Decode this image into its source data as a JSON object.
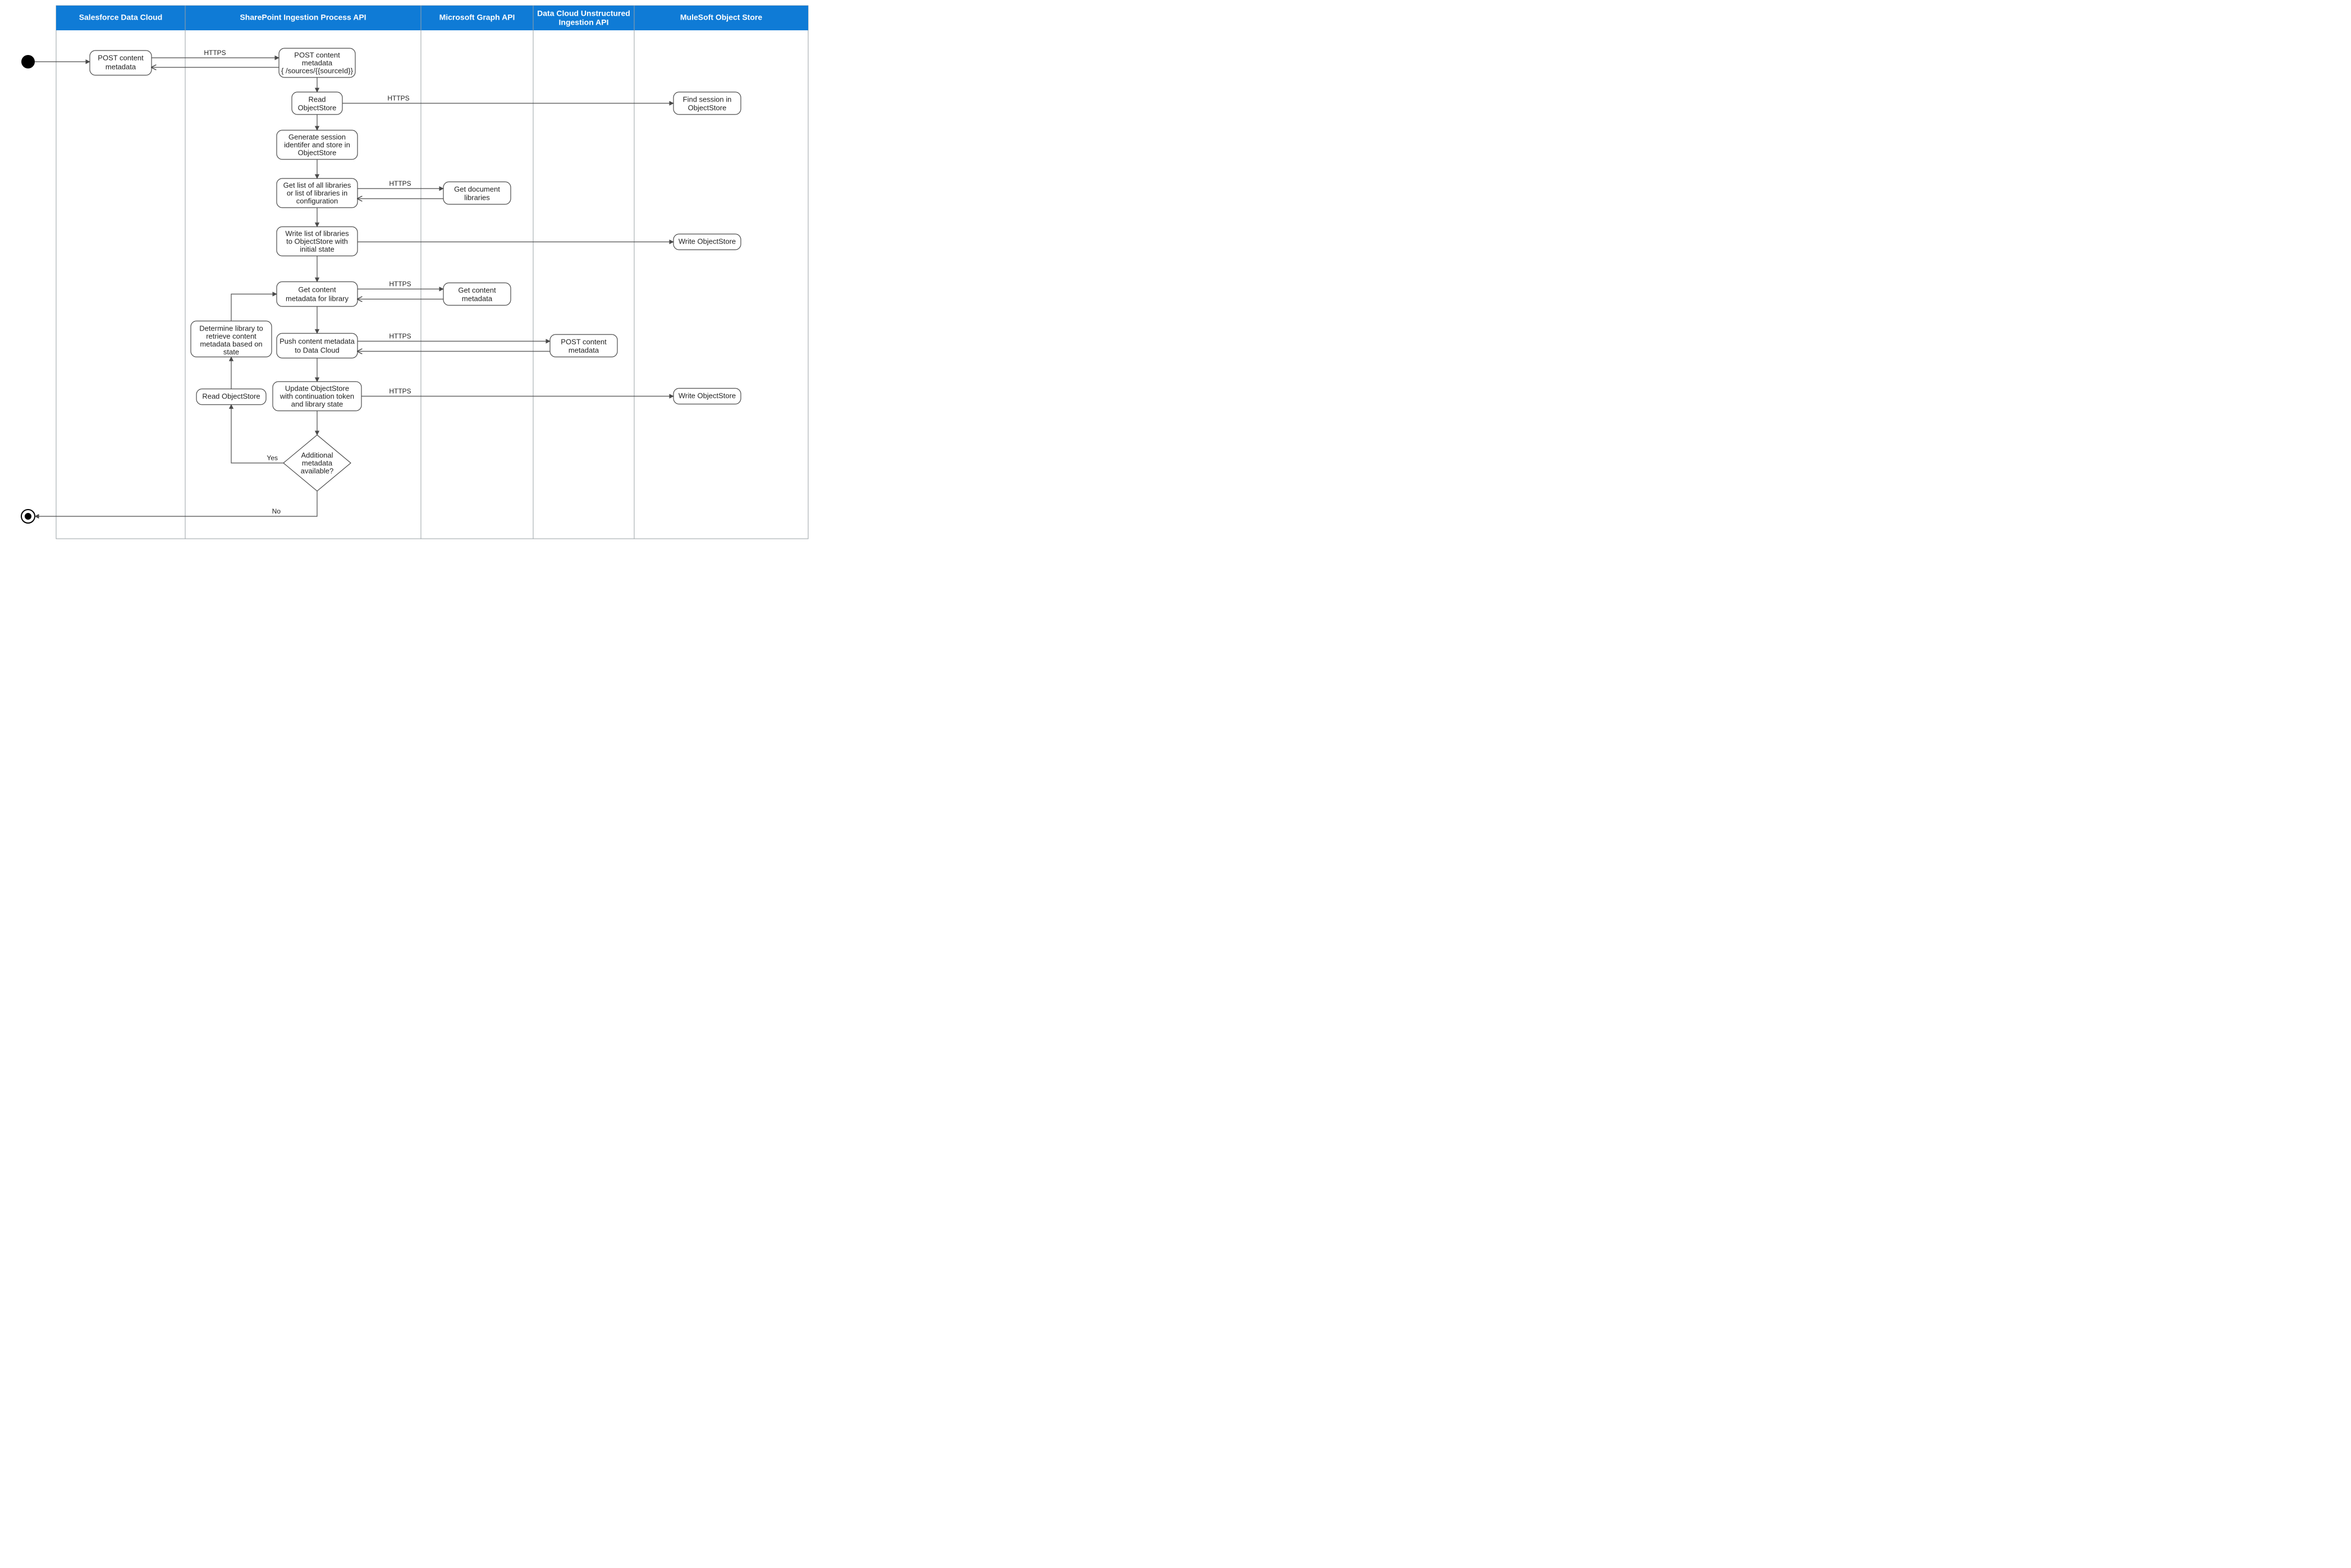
{
  "lanes": [
    {
      "id": "lane1",
      "title": "Salesforce Data Cloud"
    },
    {
      "id": "lane2",
      "title": "SharePoint Ingestion Process API"
    },
    {
      "id": "lane3",
      "title": "Microsoft Graph API"
    },
    {
      "id": "lane4",
      "title_l1": "Data Cloud Unstructured",
      "title_l2": "Ingestion API"
    },
    {
      "id": "lane5",
      "title": "MuleSoft Object Store"
    }
  ],
  "nodes": {
    "n_sf_post": {
      "l1": "POST content",
      "l2": "metadata"
    },
    "n_sp_post": {
      "l1": "POST content",
      "l2": "metadata",
      "l3": "{ /sources/{{sourceId}}"
    },
    "n_sp_readOS": {
      "l1": "Read",
      "l2": "ObjectStore"
    },
    "n_os_find": {
      "l1": "Find session in",
      "l2": "ObjectStore"
    },
    "n_sp_genSess": {
      "l1": "Generate session",
      "l2": "identifer and store in",
      "l3": "ObjectStore"
    },
    "n_sp_getLibs": {
      "l1": "Get list of all libraries",
      "l2": "or list of libraries in",
      "l3": "configuration"
    },
    "n_ms_getLibs": {
      "l1": "Get document",
      "l2": "libraries"
    },
    "n_sp_writeLibs": {
      "l1": "Write list of libraries",
      "l2": "to ObjectStore with",
      "l3": "initial state"
    },
    "n_os_write1": {
      "l1": "Write ObjectStore"
    },
    "n_sp_getMeta": {
      "l1": "Get  content",
      "l2": "metadata for library"
    },
    "n_ms_getMeta": {
      "l1": "Get content",
      "l2": "metadata"
    },
    "n_sp_detLib": {
      "l1": "Determine library  to",
      "l2": "retrieve content",
      "l3": "metadata based on",
      "l4": "state"
    },
    "n_sp_push": {
      "l1": "Push content metadata",
      "l2": "to Data Cloud"
    },
    "n_dc_post": {
      "l1": "POST content",
      "l2": "metadata"
    },
    "n_sp_update": {
      "l1": "Update ObjectStore",
      "l2": "with continuation token",
      "l3": "and library state"
    },
    "n_os_write2": {
      "l1": "Write ObjectStore"
    },
    "n_sp_readOS2": {
      "l1": "Read ObjectStore"
    },
    "n_decision": {
      "l1": "Additional",
      "l2": "metadata",
      "l3": "available?"
    }
  },
  "edge_labels": {
    "https": "HTTPS",
    "yes": "Yes",
    "no": "No"
  }
}
